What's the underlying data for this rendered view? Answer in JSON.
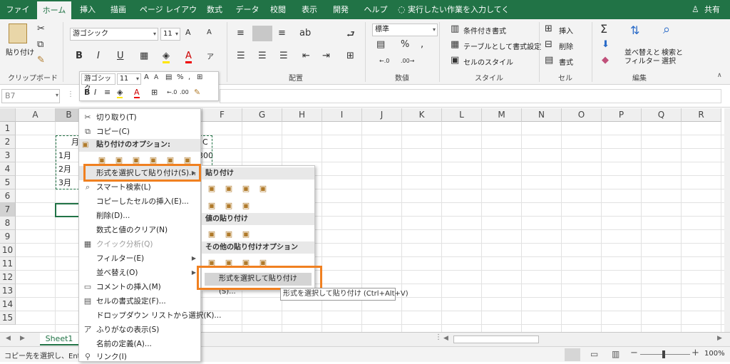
{
  "tabs": [
    "ファイル",
    "ホーム",
    "挿入",
    "描画",
    "ページ レイアウト",
    "数式",
    "データ",
    "校閲",
    "表示",
    "開発",
    "ヘルプ"
  ],
  "tell_me": "実行したい作業を入力してください",
  "share": "共有",
  "ribbon": {
    "paste": "貼り付け",
    "clipboard": "クリップボード",
    "font_name": "游ゴシック",
    "font_size": "11",
    "align": "配置",
    "number_format": "標準",
    "number": "数値",
    "cond_format": "条件付き書式",
    "table_format": "テーブルとして書式設定",
    "cell_style": "セルのスタイル",
    "style": "スタイル",
    "insert": "挿入",
    "delete": "削除",
    "format": "書式",
    "cells": "セル",
    "sort_filter_1": "並べ替えと",
    "sort_filter_2": "フィルター",
    "find_1": "検索と",
    "find_2": "選択",
    "editing": "編集"
  },
  "name_box": "B7",
  "columns": [
    "A",
    "B",
    "C",
    "D",
    "E",
    "F",
    "G",
    "H",
    "I",
    "J",
    "K",
    "L",
    "M",
    "N",
    "O",
    "P",
    "Q",
    "R"
  ],
  "rows": [
    "1",
    "2",
    "3",
    "4",
    "5",
    "6",
    "7",
    "8",
    "9",
    "10",
    "11",
    "12",
    "13",
    "14",
    "15"
  ],
  "cells": {
    "b2": "月",
    "c2_tail": "C",
    "b3": "1月",
    "c3_tail": "300",
    "b4": "2月",
    "b5": "3月"
  },
  "mini": {
    "font": "游ゴシック",
    "size": "11"
  },
  "menu": {
    "cut": "切り取り(T)",
    "copy": "コピー(C)",
    "paste_options": "貼り付けのオプション:",
    "paste_special": "形式を選択して貼り付け(S)...",
    "smart_lookup": "スマート検索(L)",
    "insert_copied": "コピーしたセルの挿入(E)...",
    "delete": "削除(D)...",
    "clear": "数式と値のクリア(N)",
    "quick_analysis": "クイック分析(Q)",
    "filter": "フィルター(E)",
    "sort": "並べ替え(O)",
    "insert_comment": "コメントの挿入(M)",
    "format_cells": "セルの書式設定(F)...",
    "dropdown": "ドロップダウン リストから選択(K)...",
    "phonetic": "ふりがなの表示(S)",
    "define_name": "名前の定義(A)...",
    "link": "リンク(I)"
  },
  "submenu": {
    "paste": "貼り付け",
    "paste_values": "値の貼り付け",
    "other": "その他の貼り付けオプション",
    "paste_special": "形式を選択して貼り付け(S)..."
  },
  "tooltip": "形式を選択して貼り付け (Ctrl+Alt+V)",
  "sheet_tab": "Sheet1",
  "status_text": "コピー先を選択し、Enter キ",
  "zoom": "100%"
}
